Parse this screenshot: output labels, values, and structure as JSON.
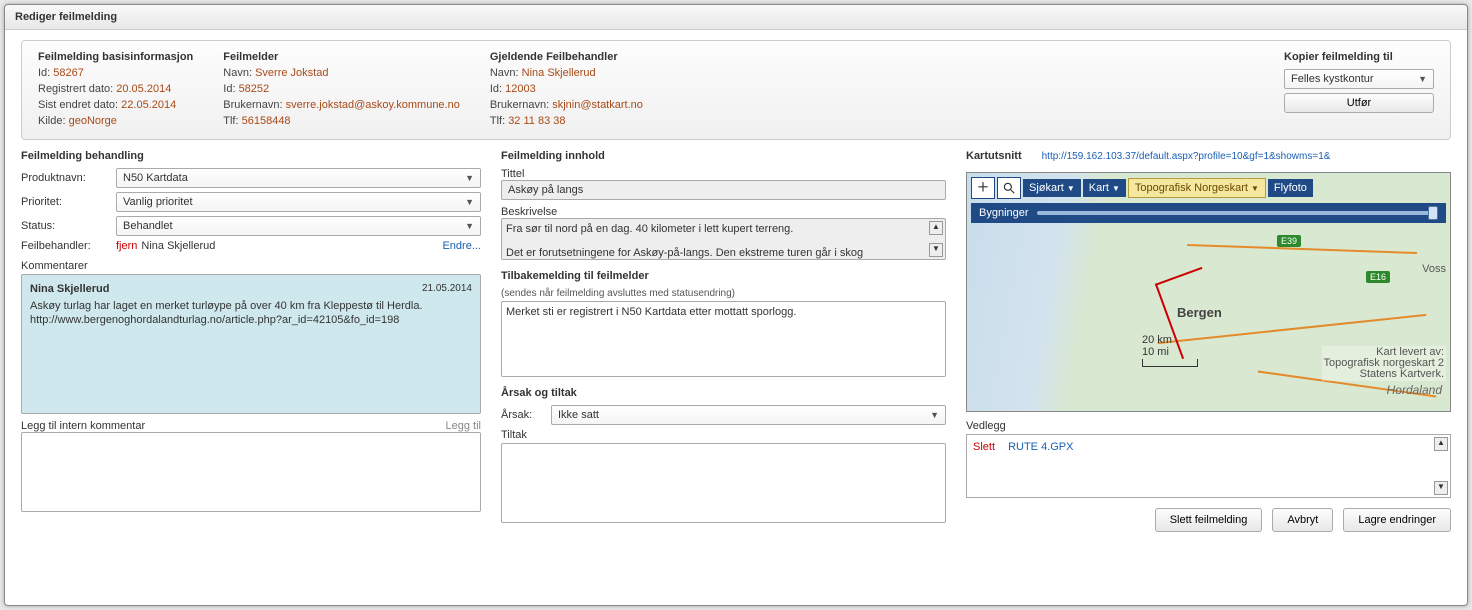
{
  "window": {
    "title": "Rediger feilmelding"
  },
  "info": {
    "basis": {
      "title": "Feilmelding basisinformasjon",
      "id_label": "Id:",
      "id": "58267",
      "reg_label": "Registrert dato:",
      "reg": "20.05.2014",
      "endret_label": "Sist endret dato:",
      "endret": "22.05.2014",
      "kilde_label": "Kilde:",
      "kilde": "geoNorge"
    },
    "melder": {
      "title": "Feilmelder",
      "navn_label": "Navn:",
      "navn": "Sverre Jokstad",
      "id_label": "Id:",
      "id": "58252",
      "bruker_label": "Brukernavn:",
      "bruker": "sverre.jokstad@askoy.kommune.no",
      "tlf_label": "Tlf:",
      "tlf": "56158448"
    },
    "behandler": {
      "title": "Gjeldende Feilbehandler",
      "navn_label": "Navn:",
      "navn": "Nina Skjellerud",
      "id_label": "Id:",
      "id": "12003",
      "bruker_label": "Brukernavn:",
      "bruker": "skjnin@statkart.no",
      "tlf_label": "Tlf:",
      "tlf": "32 11 83 38"
    },
    "kopi": {
      "title": "Kopier feilmelding til",
      "selected": "Felles kystkontur",
      "utfor": "Utfør"
    }
  },
  "behandling": {
    "title": "Feilmelding behandling",
    "produkt_label": "Produktnavn:",
    "produkt": "N50 Kartdata",
    "prioritet_label": "Prioritet:",
    "prioritet": "Vanlig prioritet",
    "status_label": "Status:",
    "status": "Behandlet",
    "feilbeh_label": "Feilbehandler:",
    "fjern": "fjern",
    "feilbeh": "Nina Skjellerud",
    "endre": "Endre...",
    "kom_title": "Kommentarer",
    "kom_name": "Nina Skjellerud",
    "kom_date": "21.05.2014",
    "kom_text": "Askøy turlag har laget en merket turløype på over 40 km fra Kleppestø til Herdla. http://www.bergenoghordalandturlag.no/article.php?ar_id=42105&fo_id=198",
    "leggtil_label": "Legg til intern kommentar",
    "leggtil_link": "Legg til"
  },
  "innhold": {
    "title": "Feilmelding innhold",
    "tittel_label": "Tittel",
    "tittel": "Askøy på langs",
    "besk_label": "Beskrivelse",
    "besk": "Fra sør til nord på en dag. 40 kilometer i lett kupert terreng.\n\nDet er forutsetningene for Askøy-på-langs. Den ekstreme turen går i skog",
    "tilbake_title": "Tilbakemelding til feilmelder",
    "tilbake_sub": "(sendes når feilmelding avsluttes med statusendring)",
    "tilbake_text": "Merket sti er registrert i N50 Kartdata etter mottatt sporlogg.",
    "arsak_title": "Årsak og tiltak",
    "arsak_label": "Årsak:",
    "arsak": "Ikke satt",
    "tiltak_label": "Tiltak"
  },
  "kart": {
    "title": "Kartutsnitt",
    "link": "http://159.162.103.37/default.aspx?profile=10&gf=1&showms=1&",
    "layer_sjokart": "Sjøkart",
    "layer_kart": "Kart",
    "layer_topo": "Topografisk Norgeskart",
    "layer_fly": "Flyfoto",
    "bygninger": "Bygninger",
    "bergen": "Bergen",
    "hordaland": "Hordaland",
    "voss": "Voss",
    "e16": "E16",
    "e39": "E39",
    "scale_km": "20 km",
    "scale_mi": "10 mi",
    "attrib1": "Kart levert av:",
    "attrib2": "Topografisk norgeskart 2",
    "attrib3": "Statens Kartverk.",
    "vedlegg_title": "Vedlegg",
    "slett": "Slett",
    "file": "RUTE 4.GPX"
  },
  "buttons": {
    "slett": "Slett feilmelding",
    "avbryt": "Avbryt",
    "lagre": "Lagre endringer"
  }
}
